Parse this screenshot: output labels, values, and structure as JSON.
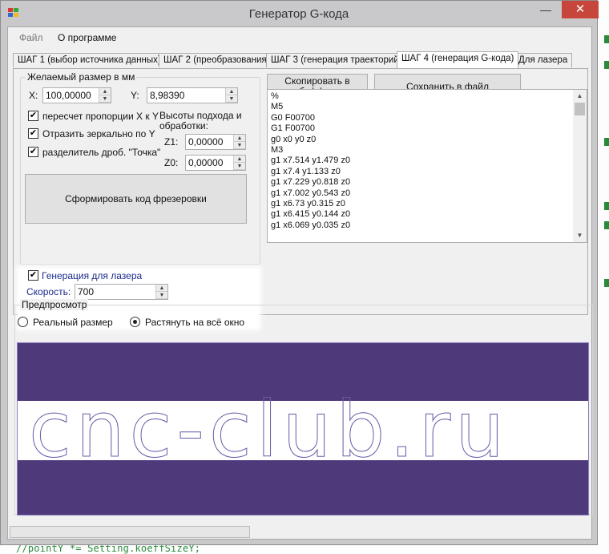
{
  "background": {
    "code_snippet": "//pointY *= Setting.koeffSizeY;"
  },
  "window": {
    "title": "Генератор G-кода",
    "minimize_glyph": "—",
    "maximize_glyph": "□",
    "close_glyph": "✕"
  },
  "menu": {
    "file": "Файл",
    "about": "О программе"
  },
  "tabs": [
    {
      "label": "ШАГ 1 (выбор источника данных)"
    },
    {
      "label": "ШАГ 2 (преобразования)"
    },
    {
      "label": "ШАГ 3 (генерация траекторий)"
    },
    {
      "label": "ШАГ 4 (генерация G-кода)"
    },
    {
      "label": "Для лазера"
    }
  ],
  "size_group": {
    "legend": "Желаемый размер в мм",
    "x_label": "X:",
    "x_value": "100,00000",
    "y_label": "Y:",
    "y_value": "8,98390"
  },
  "options": {
    "recalc_proportions": {
      "label": "пересчет пропорции X к Y",
      "checked": true
    },
    "mirror_y": {
      "label": "Отразить зеркально по Y",
      "checked": true
    },
    "decimal_point": {
      "label": "разделитель дроб. \"Точка\"",
      "checked": true
    }
  },
  "heights": {
    "label_line1": "Высоты подхода и",
    "label_line2": "обработки:",
    "z1_label": "Z1:",
    "z1_value": "0,00000",
    "z0_label": "Z0:",
    "z0_value": "0,00000"
  },
  "buttons": {
    "generate": "Сформировать код фрезеровки",
    "copy_line1": "Скопировать в",
    "copy_line2": "буффер",
    "save": "Сохранить в файл"
  },
  "laser": {
    "checkbox_label": "Генерация для лазера",
    "checked": true,
    "speed_label": "Скорость:",
    "speed_value": "700"
  },
  "gcode_lines": [
    "%",
    "M5",
    "G0 F00700",
    "G1 F00700",
    "g0 x0 y0 z0",
    "M3",
    "g1 x7.514 y1.479 z0",
    "g1 x7.4 y1.133 z0",
    "g1 x7.229 y0.818 z0",
    "g1 x7.002 y0.543 z0",
    "g1 x6.73 y0.315 z0",
    "g1 x6.415 y0.144 z0",
    "g1 x6.069 y0.035 z0"
  ],
  "preview": {
    "legend": "Предпросмотр",
    "real_size": "Реальный размер",
    "stretch": "Растянуть на всё окно",
    "selected": "stretch",
    "text": "cnc-club.ru",
    "colors": {
      "background": "#4e3a7a",
      "band": "#ffffff",
      "outline": "#6b58a8"
    }
  },
  "icons": {
    "app": "app-icon",
    "spin_up": "▲",
    "spin_down": "▼"
  }
}
